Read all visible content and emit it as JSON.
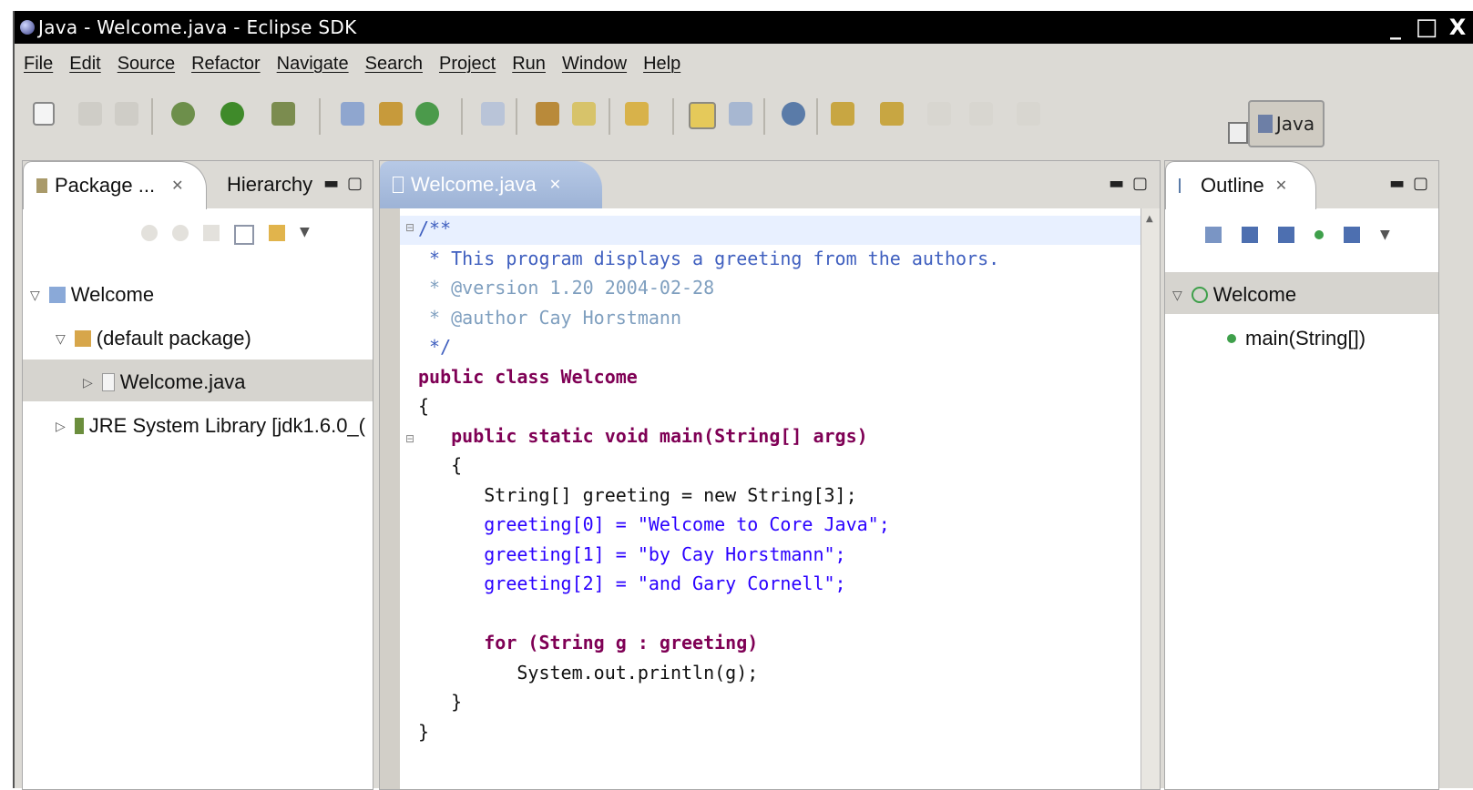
{
  "window": {
    "title": "Java - Welcome.java - Eclipse SDK",
    "controls": [
      "_",
      "□",
      "X"
    ]
  },
  "menu": [
    "File",
    "Edit",
    "Source",
    "Refactor",
    "Navigate",
    "Search",
    "Project",
    "Run",
    "Window",
    "Help"
  ],
  "toolbar": {
    "perspective_label": "Java"
  },
  "package_panel": {
    "tabs": [
      "Package ...",
      "Hierarchy"
    ],
    "tree": [
      {
        "label": "Welcome",
        "level": 0,
        "expanded": true
      },
      {
        "label": "(default package)",
        "level": 1,
        "expanded": true
      },
      {
        "label": "Welcome.java",
        "level": 2,
        "expanded": false,
        "selected": true
      },
      {
        "label": "JRE System Library [jdk1.6.0_(",
        "level": 1,
        "expanded": false
      }
    ]
  },
  "editor": {
    "tab_label": "Welcome.java",
    "code_lines": [
      "/**",
      " * This program displays a greeting from the authors.",
      " * @version 1.20 2004-02-28",
      " * @author Cay Horstmann",
      " */",
      "public class Welcome",
      "{",
      "   public static void main(String[] args)",
      "   {",
      "      String[] greeting = new String[3];",
      "      greeting[0] = \"Welcome to Core Java\";",
      "      greeting[1] = \"by Cay Horstmann\";",
      "      greeting[2] = \"and Gary Cornell\";",
      "",
      "      for (String g : greeting)",
      "         System.out.println(g);",
      "   }",
      "}"
    ]
  },
  "outline_panel": {
    "tab_label": "Outline",
    "tree": [
      {
        "label": "Welcome",
        "level": 0
      },
      {
        "label": "main(String[])",
        "level": 1
      }
    ]
  }
}
